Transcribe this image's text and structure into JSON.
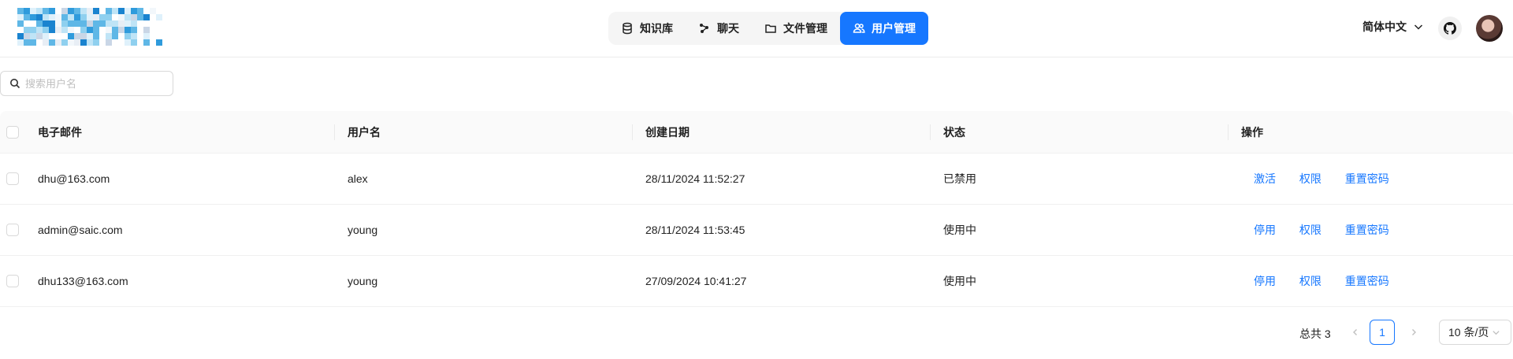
{
  "nav": {
    "items": [
      {
        "label": "知识库",
        "icon": "database-icon"
      },
      {
        "label": "聊天",
        "icon": "chat-icon"
      },
      {
        "label": "文件管理",
        "icon": "folder-icon"
      },
      {
        "label": "用户管理",
        "icon": "users-icon",
        "active": true
      }
    ]
  },
  "header": {
    "language": "简体中文"
  },
  "search": {
    "placeholder": "搜索用户名"
  },
  "table": {
    "columns": [
      "电子邮件",
      "用户名",
      "创建日期",
      "状态",
      "操作"
    ],
    "rows": [
      {
        "email": "dhu@163.com",
        "username": "alex",
        "created": "28/11/2024 11:52:27",
        "status": "已禁用",
        "toggle": "激活",
        "perm": "权限",
        "reset": "重置密码"
      },
      {
        "email": "admin@saic.com",
        "username": "young",
        "created": "28/11/2024 11:53:45",
        "status": "使用中",
        "toggle": "停用",
        "perm": "权限",
        "reset": "重置密码"
      },
      {
        "email": "dhu133@163.com",
        "username": "young",
        "created": "27/09/2024 10:41:27",
        "status": "使用中",
        "toggle": "停用",
        "perm": "权限",
        "reset": "重置密码"
      }
    ]
  },
  "pagination": {
    "total": "总共 3",
    "current": "1",
    "page_size": "10 条/页"
  },
  "colors": {
    "accent": "#1677ff"
  }
}
